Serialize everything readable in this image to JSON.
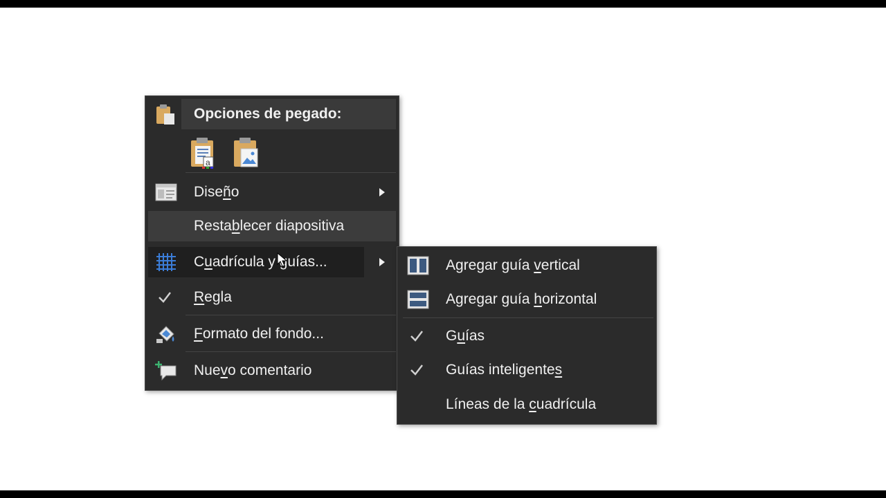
{
  "context_menu": {
    "paste_options_label": "Opciones de pegado:",
    "items": {
      "layout": {
        "pre": "Dise",
        "u": "ñ",
        "post": "o"
      },
      "reset": {
        "pre": "Resta",
        "u": "b",
        "post": "lecer diapositiva"
      },
      "grid": {
        "pre": "C",
        "u": "u",
        "post": "adrícula y guías..."
      },
      "ruler": {
        "pre": "",
        "u": "R",
        "post": "egla"
      },
      "background": {
        "pre": "",
        "u": "F",
        "post": "ormato del fondo..."
      },
      "comment": {
        "pre": "Nue",
        "u": "v",
        "post": "o comentario"
      }
    }
  },
  "submenu": {
    "items": {
      "add_vertical": {
        "pre": "Agregar guía ",
        "u": "v",
        "post": "ertical"
      },
      "add_horizontal": {
        "pre": "Agregar guía ",
        "u": "h",
        "post": "orizontal"
      },
      "guides": {
        "pre": "G",
        "u": "u",
        "post": "ías"
      },
      "smart_guides": {
        "pre": "Guías inteligente",
        "u": "s",
        "post": ""
      },
      "gridlines": {
        "pre": "Líneas de la ",
        "u": "c",
        "post": "uadrícula"
      }
    }
  },
  "colors": {
    "menu_bg": "#2b2b2b",
    "text": "#f0f0f0",
    "grid_icon": "#3b7dd8",
    "clipboard": "#d9a95f"
  }
}
